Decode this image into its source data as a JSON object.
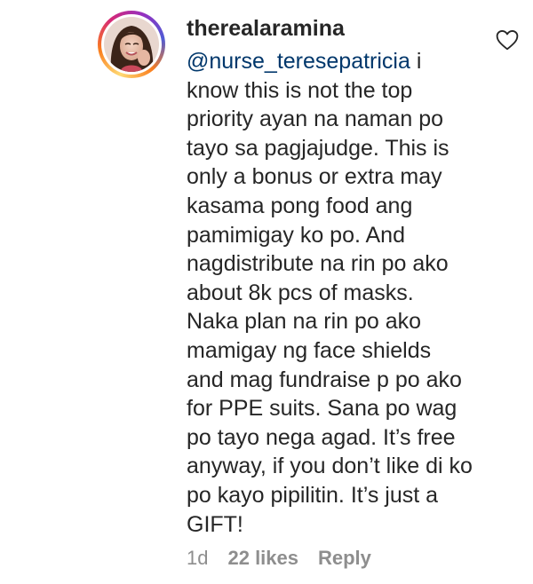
{
  "comment": {
    "username": "therealaramina",
    "mention": "@nurse_teresepatricia",
    "text_lines": [
      " i",
      "know this is not the top",
      "priority ayan na naman po",
      "tayo sa pagjajudge. This is",
      "only a bonus or extra may",
      "kasama pong food ang",
      "pamimigay ko po. And",
      "nagdistribute na rin po ako",
      "about 8k pcs of masks.",
      "Naka plan na rin po ako",
      "mamigay ng face shields",
      "and mag fundraise p po ako",
      "for PPE suits. Sana po wag",
      "po tayo nega agad. It’s free",
      "anyway, if you don’t like di ko",
      "po kayo pipilitin. It’s just a",
      "GIFT!"
    ],
    "timestamp": "1d",
    "likes": "22 likes",
    "reply_label": "Reply",
    "like_icon": "heart-outline-icon"
  },
  "colors": {
    "text": "#262626",
    "meta": "#8e8e8e",
    "mention": "#00376b",
    "icon": "#262626"
  }
}
